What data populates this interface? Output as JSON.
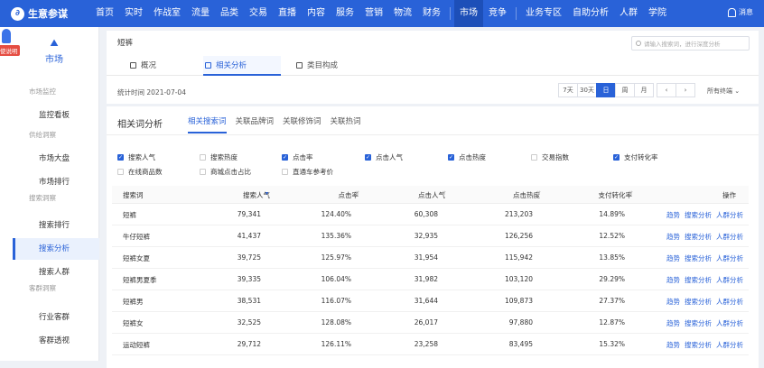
{
  "brand": {
    "name": "生意参谋",
    "logo": "∂"
  },
  "nav": {
    "items": [
      {
        "label": "首页"
      },
      {
        "label": "实时"
      },
      {
        "label": "作战室",
        "dot": true
      },
      {
        "label": "流量"
      },
      {
        "label": "品类"
      },
      {
        "label": "交易"
      },
      {
        "label": "直播",
        "dot": true
      },
      {
        "label": "内容"
      },
      {
        "label": "服务"
      },
      {
        "label": "营销"
      },
      {
        "label": "物流"
      },
      {
        "label": "财务"
      },
      {
        "label": "市场",
        "active": true
      },
      {
        "label": "竞争"
      },
      {
        "label": "业务专区"
      },
      {
        "label": "自助分析"
      },
      {
        "label": "人群"
      },
      {
        "label": "学院"
      }
    ],
    "message": "消息"
  },
  "sidebar": {
    "hint": "使说明",
    "module": {
      "label": "市场",
      "icon": "mountain-icon"
    },
    "groups": [
      {
        "label": "市场监控",
        "items": [
          {
            "label": "监控看板"
          }
        ]
      },
      {
        "label": "供给洞察",
        "items": [
          {
            "label": "市场大盘"
          },
          {
            "label": "市场排行"
          }
        ]
      },
      {
        "label": "搜索洞察",
        "items": [
          {
            "label": "搜索排行"
          },
          {
            "label": "搜索分析",
            "active": true
          },
          {
            "label": "搜索人群"
          }
        ]
      },
      {
        "label": "客群洞察",
        "items": [
          {
            "label": "行业客群"
          },
          {
            "label": "客群透视"
          }
        ]
      }
    ]
  },
  "header": {
    "keyword": "短裤",
    "search_placeholder": "请输入搜索词，进行深度分析",
    "tabs": [
      {
        "label": "概况"
      },
      {
        "label": "相关分析",
        "active": true
      },
      {
        "label": "类目构成"
      }
    ],
    "stat_time": "统计时间 2021-07-04",
    "periods": [
      {
        "label": "7天"
      },
      {
        "label": "30天"
      },
      {
        "label": "日",
        "active": true
      },
      {
        "label": "周"
      },
      {
        "label": "月"
      }
    ],
    "terminal": "所有终端"
  },
  "analysis": {
    "title": "相关词分析",
    "subtabs": [
      {
        "label": "相关搜索词",
        "active": true
      },
      {
        "label": "关联品牌词"
      },
      {
        "label": "关联修饰词"
      },
      {
        "label": "关联热词"
      }
    ],
    "metrics": [
      {
        "label": "搜索人气",
        "checked": true
      },
      {
        "label": "搜索热度",
        "checked": false
      },
      {
        "label": "点击率",
        "checked": true
      },
      {
        "label": "点击人气",
        "checked": true
      },
      {
        "label": "点击热度",
        "checked": true
      },
      {
        "label": "交易指数",
        "checked": false
      },
      {
        "label": "支付转化率",
        "checked": true
      },
      {
        "label": "在线商品数",
        "checked": false
      },
      {
        "label": "商城点击占比",
        "checked": false
      },
      {
        "label": "直通车参考价",
        "checked": false
      }
    ],
    "columns": [
      "搜索词",
      "搜索人气",
      "点击率",
      "点击人气",
      "点击热度",
      "支付转化率",
      "操作"
    ],
    "rows": [
      {
        "word": "短裤",
        "pop": "79,341",
        "ctr": "124.40%",
        "cpop": "60,308",
        "heat": "213,203",
        "conv": "14.89%"
      },
      {
        "word": "牛仔短裤",
        "pop": "41,437",
        "ctr": "135.36%",
        "cpop": "32,935",
        "heat": "126,256",
        "conv": "12.52%"
      },
      {
        "word": "短裤女夏",
        "pop": "39,725",
        "ctr": "125.97%",
        "cpop": "31,954",
        "heat": "115,942",
        "conv": "13.85%"
      },
      {
        "word": "短裤男夏季",
        "pop": "39,335",
        "ctr": "106.04%",
        "cpop": "31,982",
        "heat": "103,120",
        "conv": "29.29%"
      },
      {
        "word": "短裤男",
        "pop": "38,531",
        "ctr": "116.07%",
        "cpop": "31,644",
        "heat": "109,873",
        "conv": "27.37%"
      },
      {
        "word": "短裤女",
        "pop": "32,525",
        "ctr": "128.08%",
        "cpop": "26,017",
        "heat": "97,880",
        "conv": "12.87%"
      },
      {
        "word": "运动短裤",
        "pop": "29,712",
        "ctr": "126.11%",
        "cpop": "23,258",
        "heat": "83,495",
        "conv": "15.32%"
      }
    ],
    "ops": [
      "趋势",
      "搜索分析",
      "人群分析"
    ]
  },
  "colors": {
    "brand": "#2962d8",
    "brand_dark": "#1d4fb8",
    "badge": "#e54d42"
  }
}
